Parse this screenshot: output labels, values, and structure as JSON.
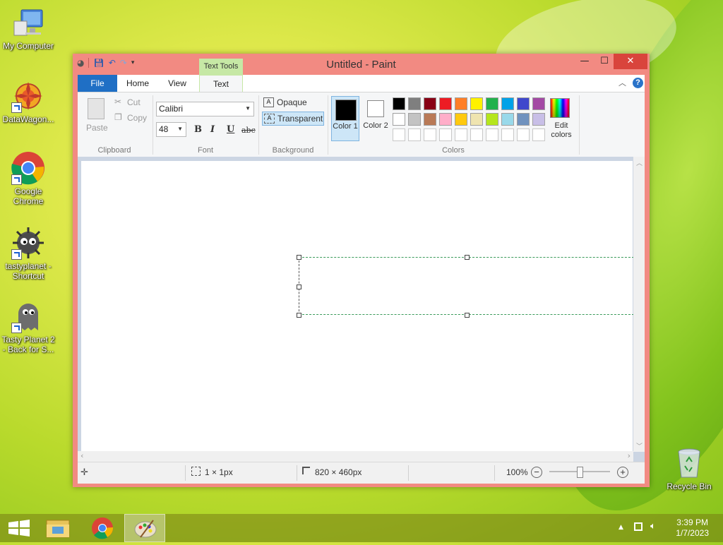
{
  "desktop": {
    "icons": [
      {
        "label": "My Computer"
      },
      {
        "label": "DataWagon..."
      },
      {
        "label": "Google Chrome"
      },
      {
        "label": "tastyplanet - Shortcut"
      },
      {
        "label": "Tasty Planet 2 - Back for S..."
      },
      {
        "label": "Recycle Bin"
      }
    ]
  },
  "window": {
    "title": "Untitled - Paint",
    "contextual_tab": "Text Tools",
    "tabs": [
      {
        "label": "File"
      },
      {
        "label": "Home"
      },
      {
        "label": "View"
      },
      {
        "label": "Text"
      }
    ],
    "ribbon": {
      "clipboard": {
        "paste": "Paste",
        "cut": "Cut",
        "copy": "Copy",
        "group": "Clipboard"
      },
      "font": {
        "family": "Calibri",
        "size": "48",
        "bold": "B",
        "italic": "I",
        "underline": "U",
        "strike": "abc",
        "group": "Font"
      },
      "background": {
        "opaque": "Opaque",
        "transparent": "Transparent",
        "group": "Background"
      },
      "colors": {
        "color1": "Color 1",
        "color2": "Color 2",
        "edit": "Edit colors",
        "group": "Colors",
        "color1_value": "#000000",
        "color2_value": "#ffffff",
        "row1": [
          "#000000",
          "#7f7f7f",
          "#880015",
          "#ed1c24",
          "#ff7f27",
          "#fff200",
          "#22b14c",
          "#00a2e8",
          "#3f48cc",
          "#a349a4"
        ],
        "row2": [
          "#ffffff",
          "#c3c3c3",
          "#b97a57",
          "#ffaec9",
          "#ffc90e",
          "#efe4b0",
          "#b5e61d",
          "#99d9ea",
          "#7092be",
          "#c8bfe7"
        ],
        "row3": [
          "#ffffff",
          "#ffffff",
          "#ffffff",
          "#ffffff",
          "#ffffff",
          "#ffffff",
          "#ffffff",
          "#ffffff",
          "#ffffff",
          "#ffffff"
        ]
      }
    },
    "status": {
      "selection": "1 × 1px",
      "canvas_size": "820 × 460px",
      "zoom": "100%"
    }
  },
  "taskbar": {
    "time": "3:39 PM",
    "date": "1/7/2023"
  }
}
